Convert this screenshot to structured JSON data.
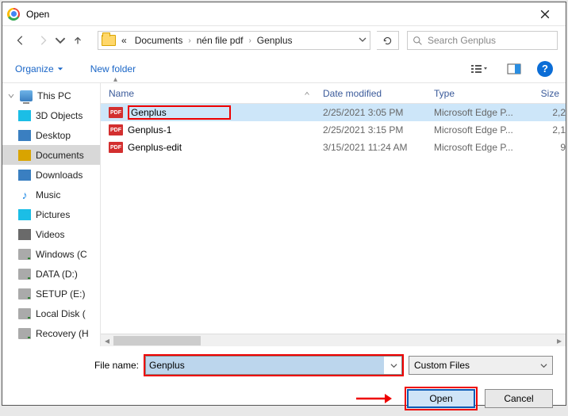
{
  "titlebar": {
    "title": "Open"
  },
  "breadcrumb": {
    "prefix": "«",
    "items": [
      "Documents",
      "nén file pdf",
      "Genplus"
    ]
  },
  "search": {
    "placeholder": "Search Genplus"
  },
  "toolbar": {
    "organize": "Organize",
    "newfolder": "New folder"
  },
  "columns": {
    "name": "Name",
    "date": "Date modified",
    "type": "Type",
    "size": "Size"
  },
  "files": [
    {
      "name": "Genplus",
      "date": "2/25/2021 3:05 PM",
      "type": "Microsoft Edge P...",
      "size": "2,2"
    },
    {
      "name": "Genplus-1",
      "date": "2/25/2021 3:15 PM",
      "type": "Microsoft Edge P...",
      "size": "2,1"
    },
    {
      "name": "Genplus-edit",
      "date": "3/15/2021 11:24 AM",
      "type": "Microsoft Edge P...",
      "size": "9"
    }
  ],
  "sidebar": {
    "root": "This PC",
    "items": [
      "3D Objects",
      "Desktop",
      "Documents",
      "Downloads",
      "Music",
      "Pictures",
      "Videos",
      "Windows (C",
      "DATA (D:)",
      "SETUP (E:)",
      "Local Disk (",
      "Recovery (H"
    ]
  },
  "bottom": {
    "filename_label": "File name:",
    "filename_value": "Genplus",
    "filetype": "Custom Files",
    "open": "Open",
    "cancel": "Cancel"
  },
  "icons": {
    "pdf": "PDF"
  }
}
